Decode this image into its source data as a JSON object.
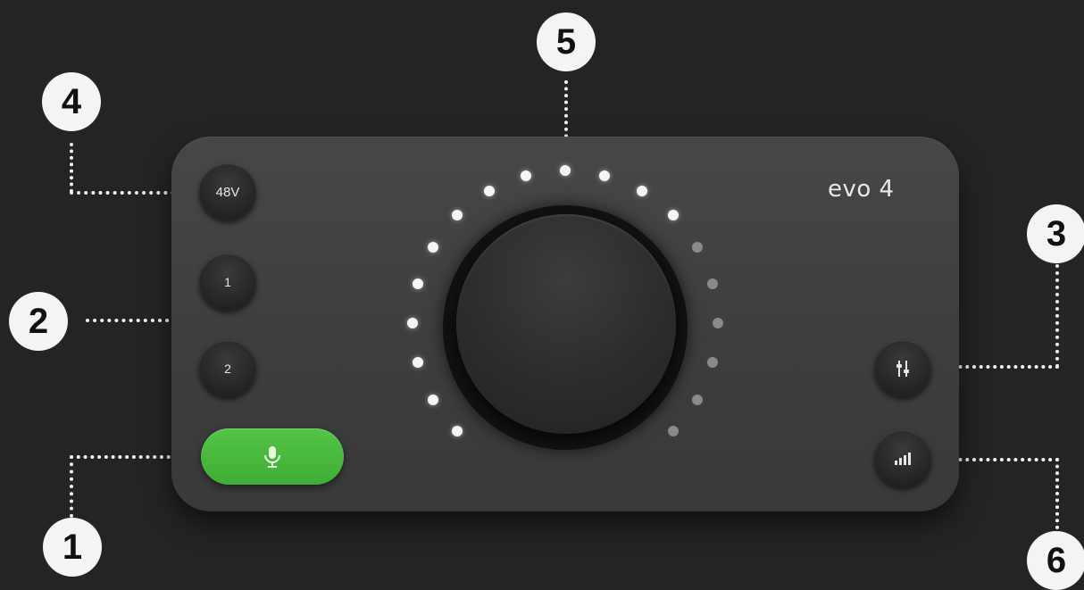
{
  "device": {
    "brand": "evo 4",
    "buttons": {
      "phantom_label": "48V",
      "input1_label": "1",
      "input2_label": "2"
    },
    "icons": {
      "mic_button": "microphone-icon",
      "mixer_button": "mixer-sliders-icon",
      "meter_button": "signal-bars-icon"
    },
    "colors": {
      "mic_button": "#4cbd40",
      "led_on": "#f5f5f5",
      "led_off": "#8a8a8a"
    },
    "level_meter": {
      "leds_total": 19,
      "leds_lit": 13,
      "level": 0.68
    }
  },
  "callouts": {
    "c1": "1",
    "c2": "2",
    "c3": "3",
    "c4": "4",
    "c5": "5",
    "c6": "6"
  }
}
